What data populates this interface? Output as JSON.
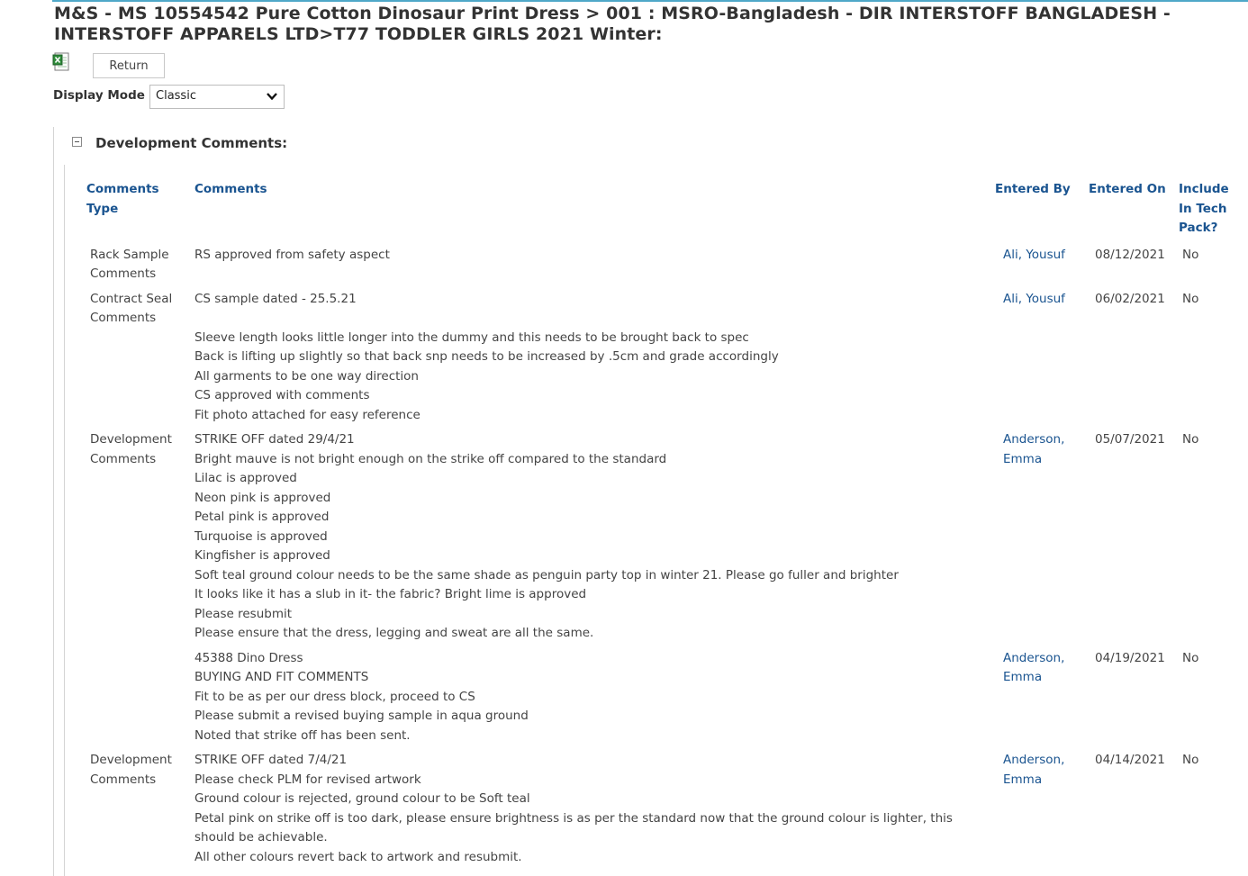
{
  "page": {
    "title": "M&S  -  MS 10554542 Pure Cotton Dinosaur Print Dress > 001 : MSRO-Bangladesh - DIR INTERSTOFF BANGLADESH - INTERSTOFF APPARELS LTD>T77 TODDLER GIRLS 2021 Winter:"
  },
  "toolbar": {
    "export_icon": "excel-icon",
    "return_label": "Return"
  },
  "display_mode": {
    "label": "Display Mode",
    "selected": "Classic"
  },
  "section": {
    "title": "Development Comments:",
    "toggle_icon": "collapse-icon"
  },
  "columns": {
    "type": "Comments Type",
    "comments": "Comments",
    "entered_by": "Entered By",
    "entered_on": "Entered On",
    "include": "Include In Tech Pack?"
  },
  "rows": [
    {
      "type": "Rack Sample Comments",
      "comments": "RS approved from safety aspect",
      "entered_by": "Ali, Yousuf",
      "entered_on": "08/12/2021",
      "include": "No"
    },
    {
      "type": "Contract Seal Comments",
      "comments": "CS sample dated - 25.5.21\n\nSleeve length looks little longer into the dummy and this needs to be brought back to spec\nBack is lifting up slightly so that back snp needs to be increased by .5cm and grade accordingly\nAll garments to be one way direction\nCS approved with comments\nFit photo attached for easy reference",
      "entered_by": "Ali, Yousuf",
      "entered_on": "06/02/2021",
      "include": "No"
    },
    {
      "type": "Development Comments",
      "comments": "STRIKE OFF dated 29/4/21\nBright mauve is not bright enough on the strike off compared to the standard\nLilac is approved\nNeon pink is approved\nPetal pink is approved\nTurquoise is approved\nKingfisher is approved\nSoft teal ground colour needs to be the same shade as penguin party top in winter 21. Please go fuller and brighter\nIt looks like it has a slub in it- the fabric? Bright lime is approved\nPlease resubmit\nPlease ensure that the dress, legging and sweat are all the same.",
      "entered_by": "Anderson, Emma",
      "entered_on": "05/07/2021",
      "include": "No"
    },
    {
      "type": "",
      "comments": "45388 Dino Dress\nBUYING AND FIT COMMENTS\nFit to be as per our dress block, proceed to CS\nPlease submit a revised buying sample in aqua ground\nNoted that strike off has been sent.",
      "entered_by": "Anderson, Emma",
      "entered_on": "04/19/2021",
      "include": "No"
    },
    {
      "type": "Development Comments",
      "comments": "STRIKE OFF dated 7/4/21\nPlease check PLM for revised artwork\nGround colour is rejected, ground colour to be Soft teal\nPetal pink on strike off is too dark, please ensure brightness is as per the standard now that the ground colour is lighter, this should be achievable.\nAll other colours revert back to artwork and resubmit.",
      "entered_by": "Anderson, Emma",
      "entered_on": "04/14/2021",
      "include": "No"
    }
  ]
}
